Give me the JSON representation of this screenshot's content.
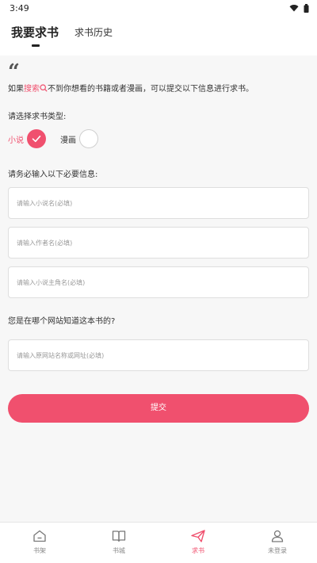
{
  "status_bar": {
    "time": "3:49"
  },
  "header": {
    "title": "我要求书",
    "history_tab": "求书历史"
  },
  "intro": {
    "prefix": "如果",
    "link": "搜索",
    "suffix": "不到你想看的书籍或者漫画，可以提交以下信息进行求书。"
  },
  "type_section": {
    "label": "请选择求书类型:",
    "options": [
      {
        "label": "小说",
        "selected": true
      },
      {
        "label": "漫画",
        "selected": false
      }
    ]
  },
  "required_section": {
    "label": "请务必输入以下必要信息:"
  },
  "fields": {
    "novel_name": {
      "placeholder": "请输入小说名(必填)",
      "value": ""
    },
    "author": {
      "placeholder": "请输入作者名(必填)",
      "value": ""
    },
    "protagonist": {
      "placeholder": "请输入小说主角名(必填)",
      "value": ""
    },
    "website": {
      "placeholder": "请输入原网站名称或网址(必填)",
      "value": ""
    }
  },
  "website_section": {
    "label": "您是在哪个网站知道这本书的?"
  },
  "submit_label": "提交",
  "bottom_nav": [
    {
      "label": "书架",
      "icon": "home-icon",
      "active": false
    },
    {
      "label": "书城",
      "icon": "book-icon",
      "active": false
    },
    {
      "label": "求书",
      "icon": "send-icon",
      "active": true
    },
    {
      "label": "未登录",
      "icon": "user-icon",
      "active": false
    }
  ],
  "colors": {
    "accent": "#f0506e",
    "background": "#f7f7f7"
  }
}
